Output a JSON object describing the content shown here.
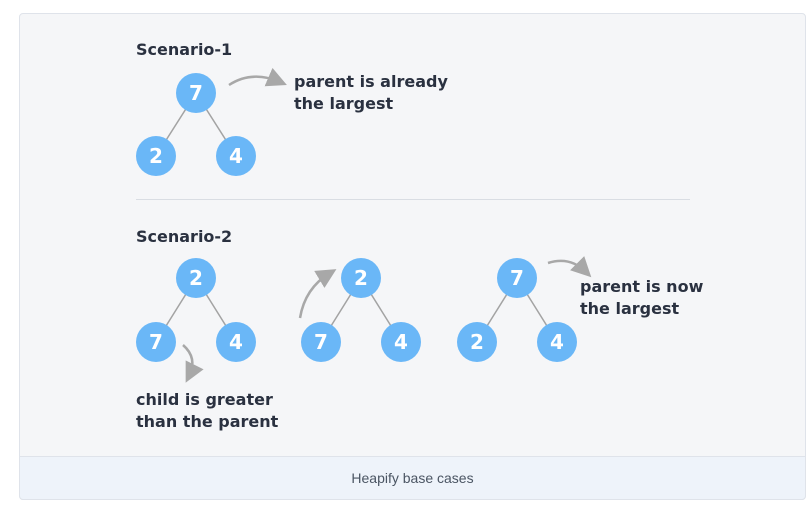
{
  "scenario1": {
    "heading": "Scenario-1",
    "tree": {
      "root": "7",
      "left": "2",
      "right": "4"
    },
    "note_line1": "parent is already",
    "note_line2": "the largest"
  },
  "scenario2": {
    "heading": "Scenario-2",
    "tree_a": {
      "root": "2",
      "left": "7",
      "right": "4"
    },
    "tree_a_note_line1": "child is greater",
    "tree_a_note_line2": "than the parent",
    "tree_b": {
      "root": "2",
      "left": "7",
      "right": "4"
    },
    "tree_c": {
      "root": "7",
      "left": "2",
      "right": "4"
    },
    "tree_c_note_line1": "parent is now",
    "tree_c_note_line2": "the largest"
  },
  "caption": "Heapify base cases",
  "colors": {
    "node": "#6ab7f7",
    "edge": "#a3a3a3",
    "arrow": "#a8a8a8",
    "text": "#2a3140"
  }
}
